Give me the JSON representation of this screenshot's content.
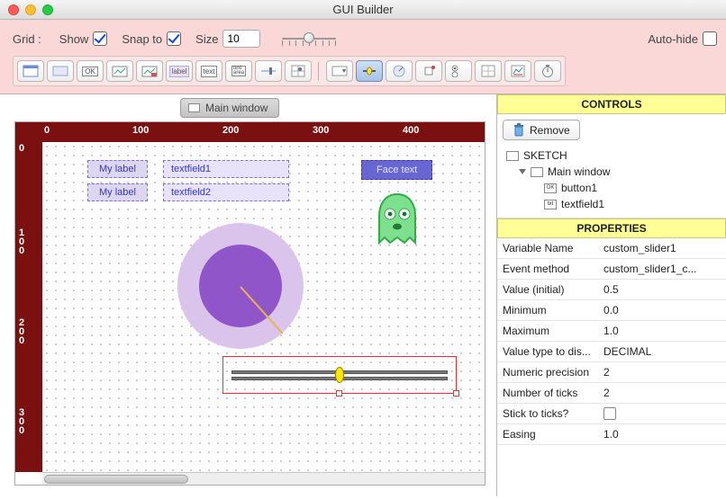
{
  "window": {
    "title": "GUI Builder"
  },
  "topbar": {
    "grid_label": "Grid :",
    "show_label": "Show",
    "show_checked": true,
    "snap_label": "Snap to",
    "snap_checked": true,
    "size_label": "Size",
    "size_value": "10",
    "autohide_label": "Auto-hide",
    "autohide_checked": false
  },
  "toolbar": {
    "items": [
      {
        "name": "window-icon"
      },
      {
        "name": "panel-icon"
      },
      {
        "name": "ok-button-icon"
      },
      {
        "name": "image-button-icon"
      },
      {
        "name": "image-toggle-icon"
      },
      {
        "name": "label-icon"
      },
      {
        "name": "text-icon"
      },
      {
        "name": "textarea-icon"
      },
      {
        "name": "slider-icon"
      },
      {
        "name": "slider2d-icon"
      },
      {
        "name": "droplist-icon"
      },
      {
        "name": "custom-slider-icon",
        "active": true
      },
      {
        "name": "knob-icon"
      },
      {
        "name": "checkbox-icon"
      },
      {
        "name": "option-icon"
      },
      {
        "name": "stick-icon"
      },
      {
        "name": "sketchpad-icon"
      },
      {
        "name": "timer-icon"
      }
    ]
  },
  "tab": {
    "label": "Main window"
  },
  "ruler": {
    "top": [
      "0",
      "100",
      "200",
      "300",
      "400"
    ],
    "left": [
      "0",
      "100",
      "200",
      "300"
    ]
  },
  "canvas": {
    "label1": "My label",
    "label2": "My label",
    "field1": "textfield1",
    "field2": "textfield2",
    "face": "Face text"
  },
  "controls_panel": {
    "header": "CONTROLS",
    "remove": "Remove",
    "tree": {
      "root": "SKETCH",
      "child": "Main window",
      "leaf1": "button1",
      "leaf2": "textfield1"
    }
  },
  "props_panel": {
    "header": "PROPERTIES",
    "rows": [
      {
        "k": "Variable Name",
        "v": "custom_slider1"
      },
      {
        "k": "Event method",
        "v": "custom_slider1_c..."
      },
      {
        "k": "Value (initial)",
        "v": "0.5"
      },
      {
        "k": "Minimum",
        "v": "0.0"
      },
      {
        "k": "Maximum",
        "v": "1.0"
      },
      {
        "k": "Value type to dis...",
        "v": "DECIMAL"
      },
      {
        "k": "Numeric precision",
        "v": "2"
      },
      {
        "k": "Number of ticks",
        "v": "2"
      },
      {
        "k": "Stick to ticks?",
        "v": "",
        "chk": true
      },
      {
        "k": "Easing",
        "v": "1.0"
      }
    ]
  }
}
